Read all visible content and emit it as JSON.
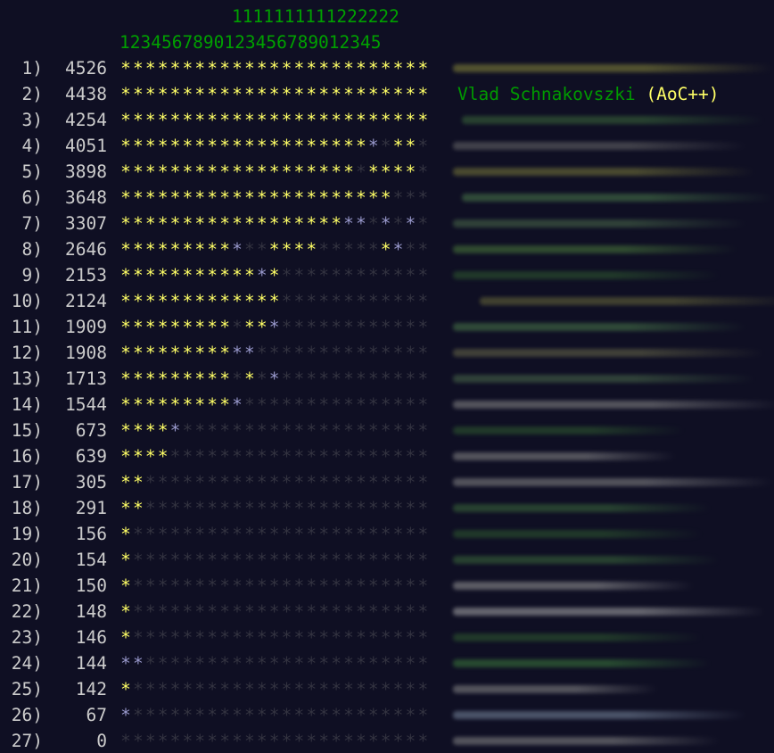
{
  "header": {
    "tens_line": "1111111111222222",
    "ones_line": "1234567890123456789012345"
  },
  "rows": [
    {
      "rank": "1)",
      "score": "4526",
      "stars": "2222222222222222222222222",
      "name": "",
      "supporter": "",
      "blur_color": "#8a8a3a"
    },
    {
      "rank": "2)",
      "score": "4438",
      "stars": "2222222222222222222222222",
      "name": "Vlad Schnakovszki",
      "supporter": "(AoC++)",
      "blur_color": ""
    },
    {
      "rank": "3)",
      "score": "4254",
      "stars": "2222222222222222222222222",
      "name": "",
      "supporter": "",
      "blur_color": "#3b6a3b"
    },
    {
      "rank": "4)",
      "score": "4051",
      "stars": "2222222222222222222210220",
      "name": "",
      "supporter": "",
      "blur_color": "#6a6a6a"
    },
    {
      "rank": "5)",
      "score": "3898",
      "stars": "2222222222222222222022220",
      "name": "",
      "supporter": "",
      "blur_color": "#7a7a3a"
    },
    {
      "rank": "6)",
      "score": "3648",
      "stars": "2222222222222222222222000",
      "name": "",
      "supporter": "",
      "blur_color": "#4a7a4a"
    },
    {
      "rank": "7)",
      "score": "3307",
      "stars": "2222222222222222221101010",
      "name": "",
      "supporter": "",
      "blur_color": "#4a6a4a"
    },
    {
      "rank": "8)",
      "score": "2646",
      "stars": "2222222221002222000002100",
      "name": "",
      "supporter": "",
      "blur_color": "#4a7a3a"
    },
    {
      "rank": "9)",
      "score": "2153",
      "stars": "2222222222212000000000000",
      "name": "",
      "supporter": "",
      "blur_color": "#2f5a2f"
    },
    {
      "rank": "10)",
      "score": "2124",
      "stars": "2222222222222000000000000",
      "name": "",
      "supporter": "",
      "blur_color": "#6a6a3a"
    },
    {
      "rank": "11)",
      "score": "1909",
      "stars": "2222222220221000000000000",
      "name": "",
      "supporter": "",
      "blur_color": "#4a7a4a"
    },
    {
      "rank": "12)",
      "score": "1908",
      "stars": "2222222221100000000000000",
      "name": "",
      "supporter": "",
      "blur_color": "#6a6a4a"
    },
    {
      "rank": "13)",
      "score": "1713",
      "stars": "2222222220201000000000000",
      "name": "",
      "supporter": "",
      "blur_color": "#4a6a4a"
    },
    {
      "rank": "14)",
      "score": "1544",
      "stars": "2222222221000000000000000",
      "name": "",
      "supporter": "",
      "blur_color": "#8a8a8a"
    },
    {
      "rank": "15)",
      "score": "673",
      "stars": "2222100000000000000000000",
      "name": "",
      "supporter": "",
      "blur_color": "#2f5a2f"
    },
    {
      "rank": "16)",
      "score": "639",
      "stars": "2222000000000000000000000",
      "name": "",
      "supporter": "",
      "blur_color": "#8a8a8a"
    },
    {
      "rank": "17)",
      "score": "305",
      "stars": "2200000000000000000000000",
      "name": "",
      "supporter": "",
      "blur_color": "#8a8a8a"
    },
    {
      "rank": "18)",
      "score": "291",
      "stars": "2200000000000000000000000",
      "name": "",
      "supporter": "",
      "blur_color": "#3b6a3b"
    },
    {
      "rank": "19)",
      "score": "156",
      "stars": "2000000000000000000000000",
      "name": "",
      "supporter": "",
      "blur_color": "#2f5a2f"
    },
    {
      "rank": "20)",
      "score": "154",
      "stars": "2000000000000000000000000",
      "name": "",
      "supporter": "",
      "blur_color": "#3b6a3b"
    },
    {
      "rank": "21)",
      "score": "150",
      "stars": "2000000000000000000000000",
      "name": "",
      "supporter": "",
      "blur_color": "#9a9a9a"
    },
    {
      "rank": "22)",
      "score": "148",
      "stars": "2000000000000000000000000",
      "name": "",
      "supporter": "",
      "blur_color": "#aaaaaa"
    },
    {
      "rank": "23)",
      "score": "146",
      "stars": "2000000000000000000000000",
      "name": "",
      "supporter": "",
      "blur_color": "#2f5a2f"
    },
    {
      "rank": "24)",
      "score": "144",
      "stars": "1100000000000000000000000",
      "name": "",
      "supporter": "",
      "blur_color": "#3b7a3b"
    },
    {
      "rank": "25)",
      "score": "142",
      "stars": "2000000000000000000000000",
      "name": "",
      "supporter": "",
      "blur_color": "#8a8a8a"
    },
    {
      "rank": "26)",
      "score": "67",
      "stars": "1000000000000000000000000",
      "name": "",
      "supporter": "",
      "blur_color": "#7a8aa0"
    },
    {
      "rank": "27)",
      "score": "0",
      "stars": "0000000000000000000000000",
      "name": "",
      "supporter": "",
      "blur_color": "#8a8a8a"
    }
  ],
  "colors": {
    "background": "#0f0f23",
    "gold_star": "#ffff66",
    "silver_star": "#9999cc",
    "empty_star": "#333340",
    "header_digits": "#00a000",
    "name": "#009900",
    "supporter": "#ffff66"
  }
}
